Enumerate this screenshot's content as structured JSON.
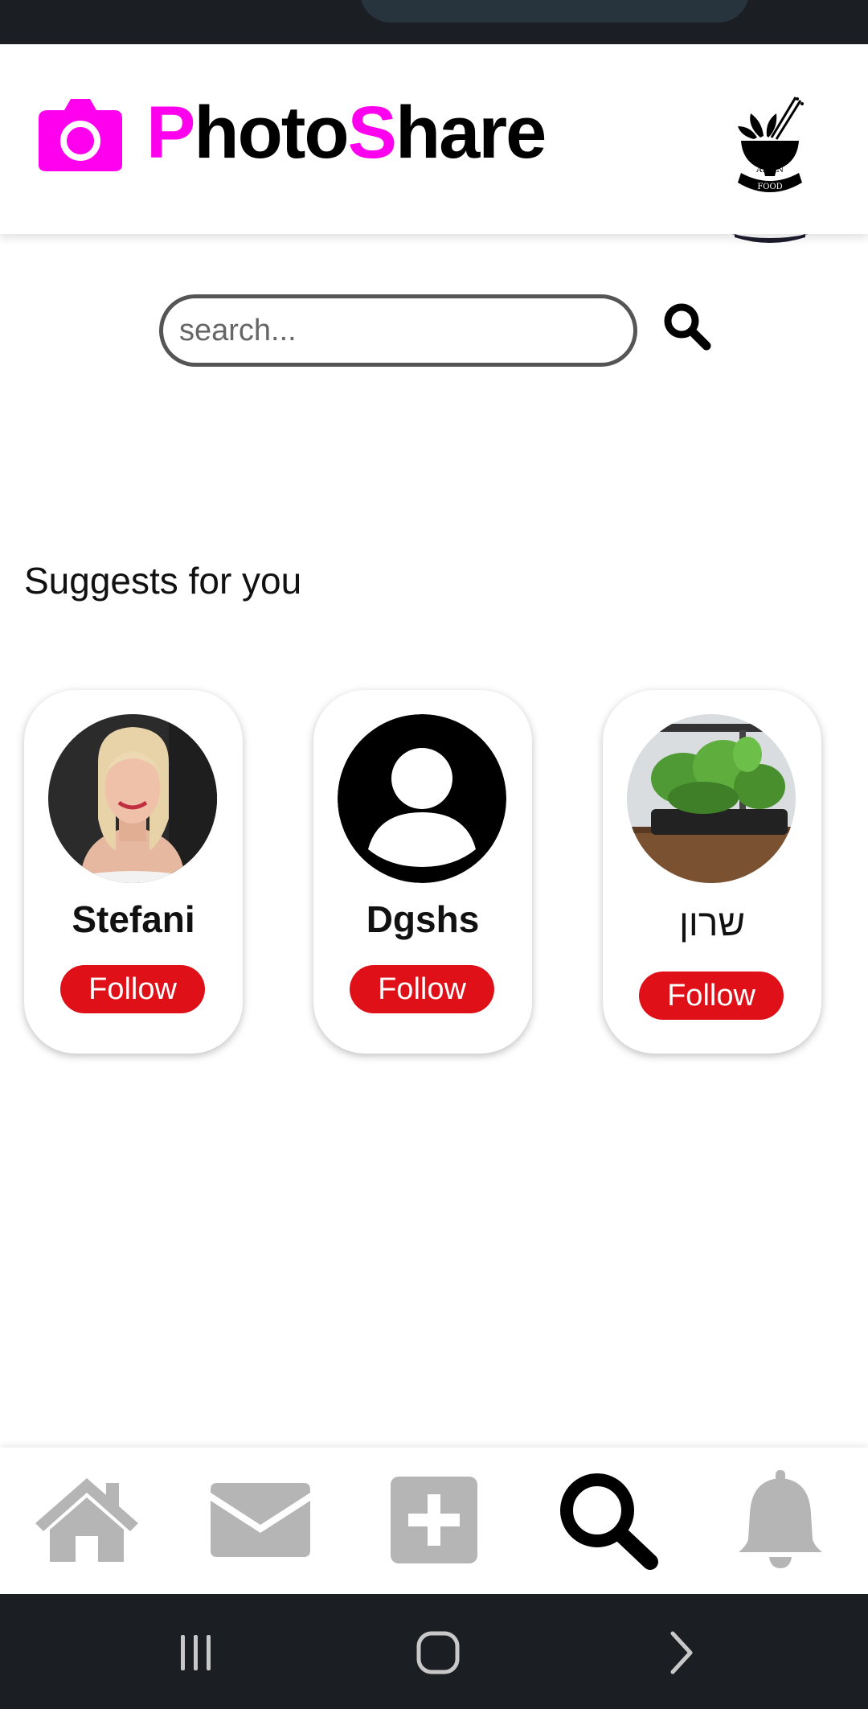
{
  "app": {
    "title_first_letter": "P",
    "title_part1": "hoto",
    "title_second_letter": "S",
    "title_part2": "hare",
    "brand_color": "#ff00ee"
  },
  "profile_logo": {
    "text_line1": "ASIAN",
    "text_line2": "FOOD",
    "icon": "asian-food-logo"
  },
  "search": {
    "placeholder": "search...",
    "icon": "search-icon"
  },
  "suggestions": {
    "title": "Suggests for you",
    "users": [
      {
        "name": "Stefani",
        "follow_label": "Follow",
        "avatar": "photo"
      },
      {
        "name": "Dgshs",
        "follow_label": "Follow",
        "avatar": "default-user-icon"
      },
      {
        "name": "שרון",
        "follow_label": "Follow",
        "avatar": "plant-photo"
      }
    ]
  },
  "bottom_nav": {
    "items": [
      {
        "icon": "home-icon",
        "active": false
      },
      {
        "icon": "mail-icon",
        "active": false
      },
      {
        "icon": "add-icon",
        "active": false
      },
      {
        "icon": "search-icon",
        "active": true
      },
      {
        "icon": "bell-icon",
        "active": false
      }
    ],
    "active_color": "#000000",
    "inactive_color": "#b5b5b5"
  },
  "system_nav": {
    "items": [
      "recents-icon",
      "home-icon",
      "back-icon"
    ]
  },
  "colors": {
    "follow_button": "#e01018",
    "status_bar": "#1b1e22"
  }
}
